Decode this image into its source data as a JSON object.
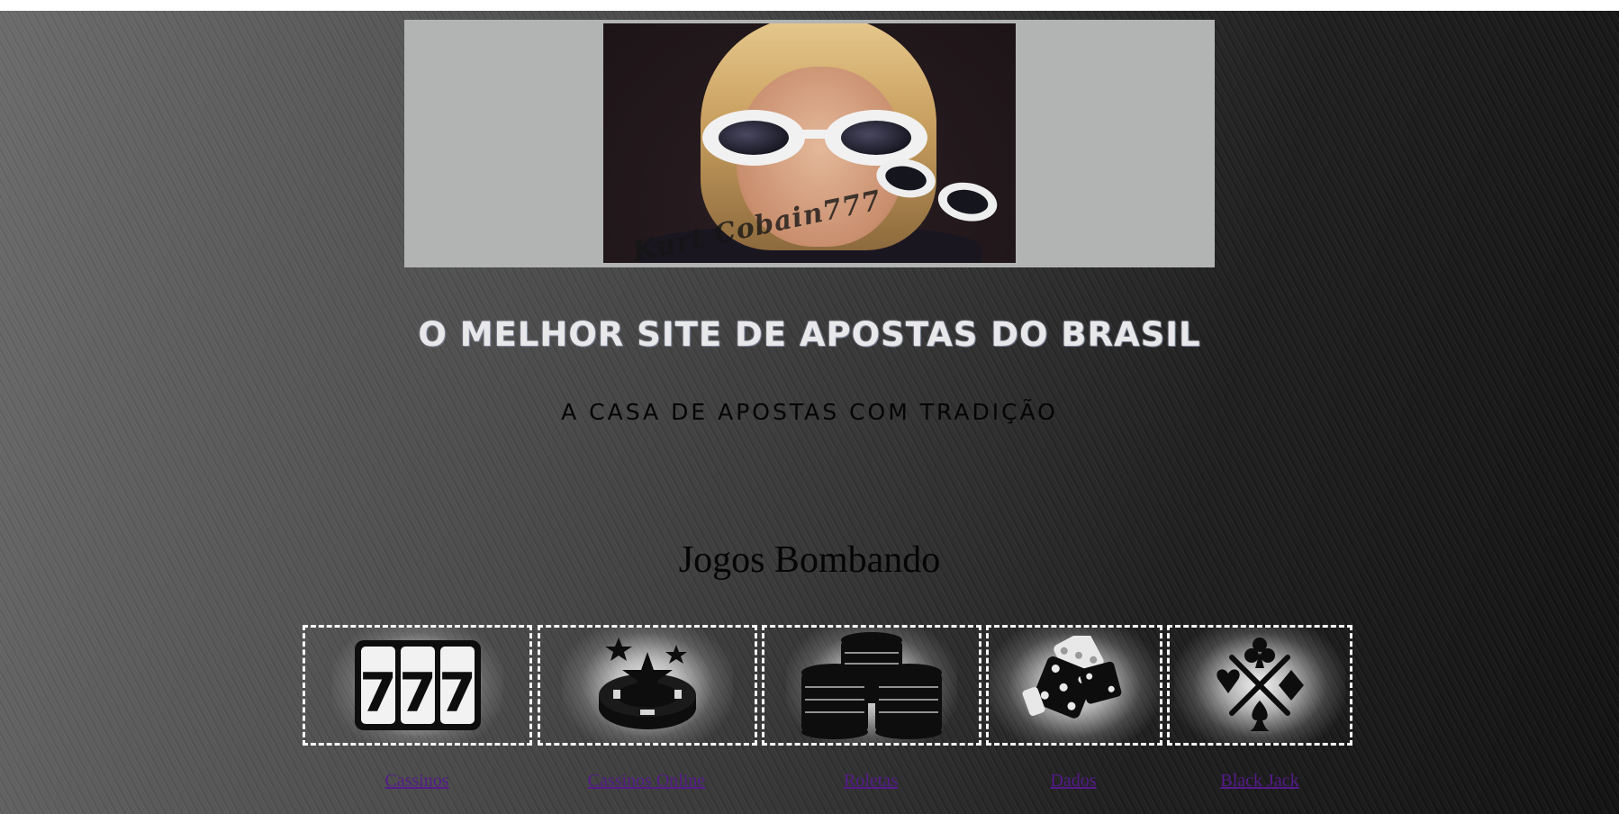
{
  "banner": {
    "signature": "Kurt Cobain777"
  },
  "hero": {
    "headline": "O MELHOR SITE DE APOSTAS DO BRASIL",
    "subheadline": "A CASA DE APOSTAS COM TRADIÇÃO"
  },
  "games": {
    "title": "Jogos Bombando",
    "items": [
      {
        "label": "Cassinos",
        "icon": "slot-machine-777-icon"
      },
      {
        "label": "Cassinos Online",
        "icon": "casino-chip-stars-icon"
      },
      {
        "label": "Roletas",
        "icon": "chip-stacks-icon"
      },
      {
        "label": "Dados",
        "icon": "dice-icon"
      },
      {
        "label": "Black Jack",
        "icon": "card-suits-icon"
      }
    ]
  },
  "colors": {
    "link": "#551a8b",
    "headline": "#e8e8ea",
    "banner_bg": "#b2b4b3",
    "card_border": "#ffffff"
  }
}
